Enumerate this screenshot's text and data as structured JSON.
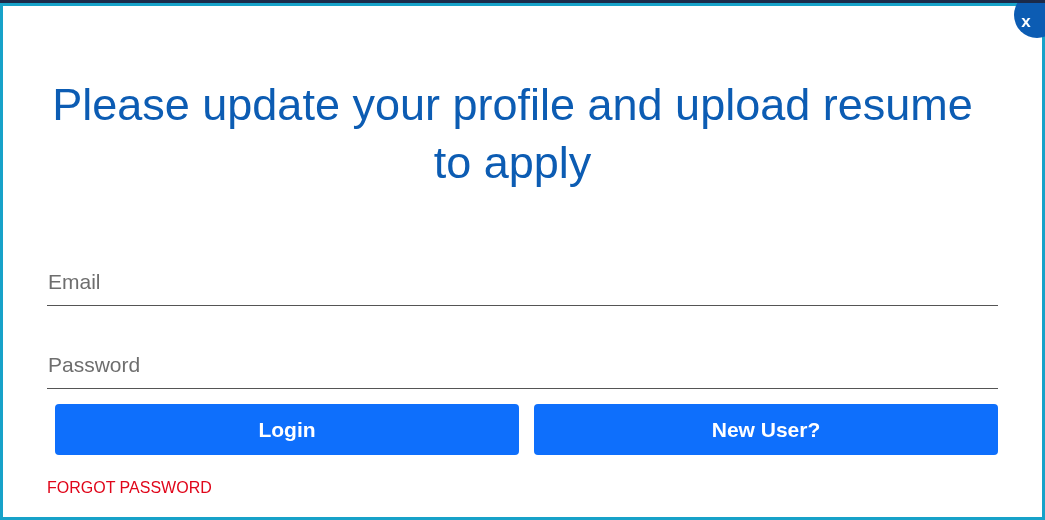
{
  "dialog": {
    "title": "Please update your profile and upload resume to apply",
    "close": "x"
  },
  "fields": [
    {
      "placeholder": "Email"
    },
    {
      "placeholder": "Password"
    }
  ],
  "buttons": [
    "Login",
    "New User?"
  ],
  "link": "FORGOT PASSWORD"
}
